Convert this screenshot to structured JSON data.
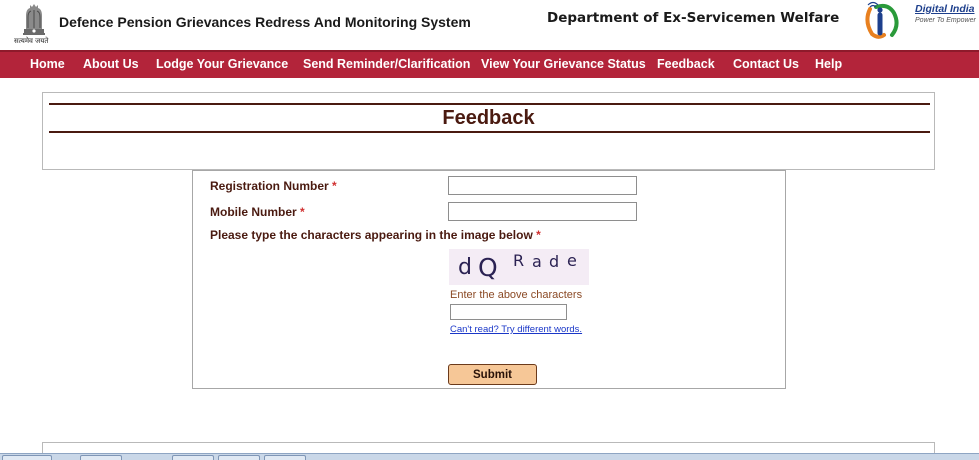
{
  "header": {
    "motto": "सत्यमेव जयते",
    "site_title": "Defence Pension Grievances Redress And Monitoring System",
    "department": "Department of Ex-Servicemen Welfare",
    "digital_india": {
      "title": "Digital India",
      "tagline": "Power To Empower"
    }
  },
  "nav": {
    "items": [
      {
        "label": "Home"
      },
      {
        "label": "About Us"
      },
      {
        "label": "Lodge Your Grievance"
      },
      {
        "label": "Send Reminder/Clarification"
      },
      {
        "label": "View Your Grievance Status"
      },
      {
        "label": "Feedback"
      },
      {
        "label": "Contact Us"
      },
      {
        "label": "Help"
      }
    ]
  },
  "page": {
    "title": "Feedback"
  },
  "form": {
    "registration_label": "Registration Number",
    "mobile_label": "Mobile Number",
    "captcha_label": "Please type the characters appearing in the image below",
    "required_mark": "*",
    "registration_value": "",
    "mobile_value": "",
    "captcha_value": "",
    "captcha_chars": [
      "d",
      "Q",
      "R",
      "a",
      "d",
      "e"
    ],
    "captcha_hint": "Enter the above characters",
    "captcha_refresh": "Can't read? Try different words.",
    "submit_label": "Submit"
  },
  "colors": {
    "nav_bg": "#b3243a",
    "heading": "#4a1a10",
    "required": "#d03030",
    "submit_bg": "#f6c797",
    "link": "#1a37c8",
    "captcha_bg": "#f4ecf5"
  },
  "icons": [
    "national-emblem-icon",
    "digital-india-logo-icon"
  ]
}
